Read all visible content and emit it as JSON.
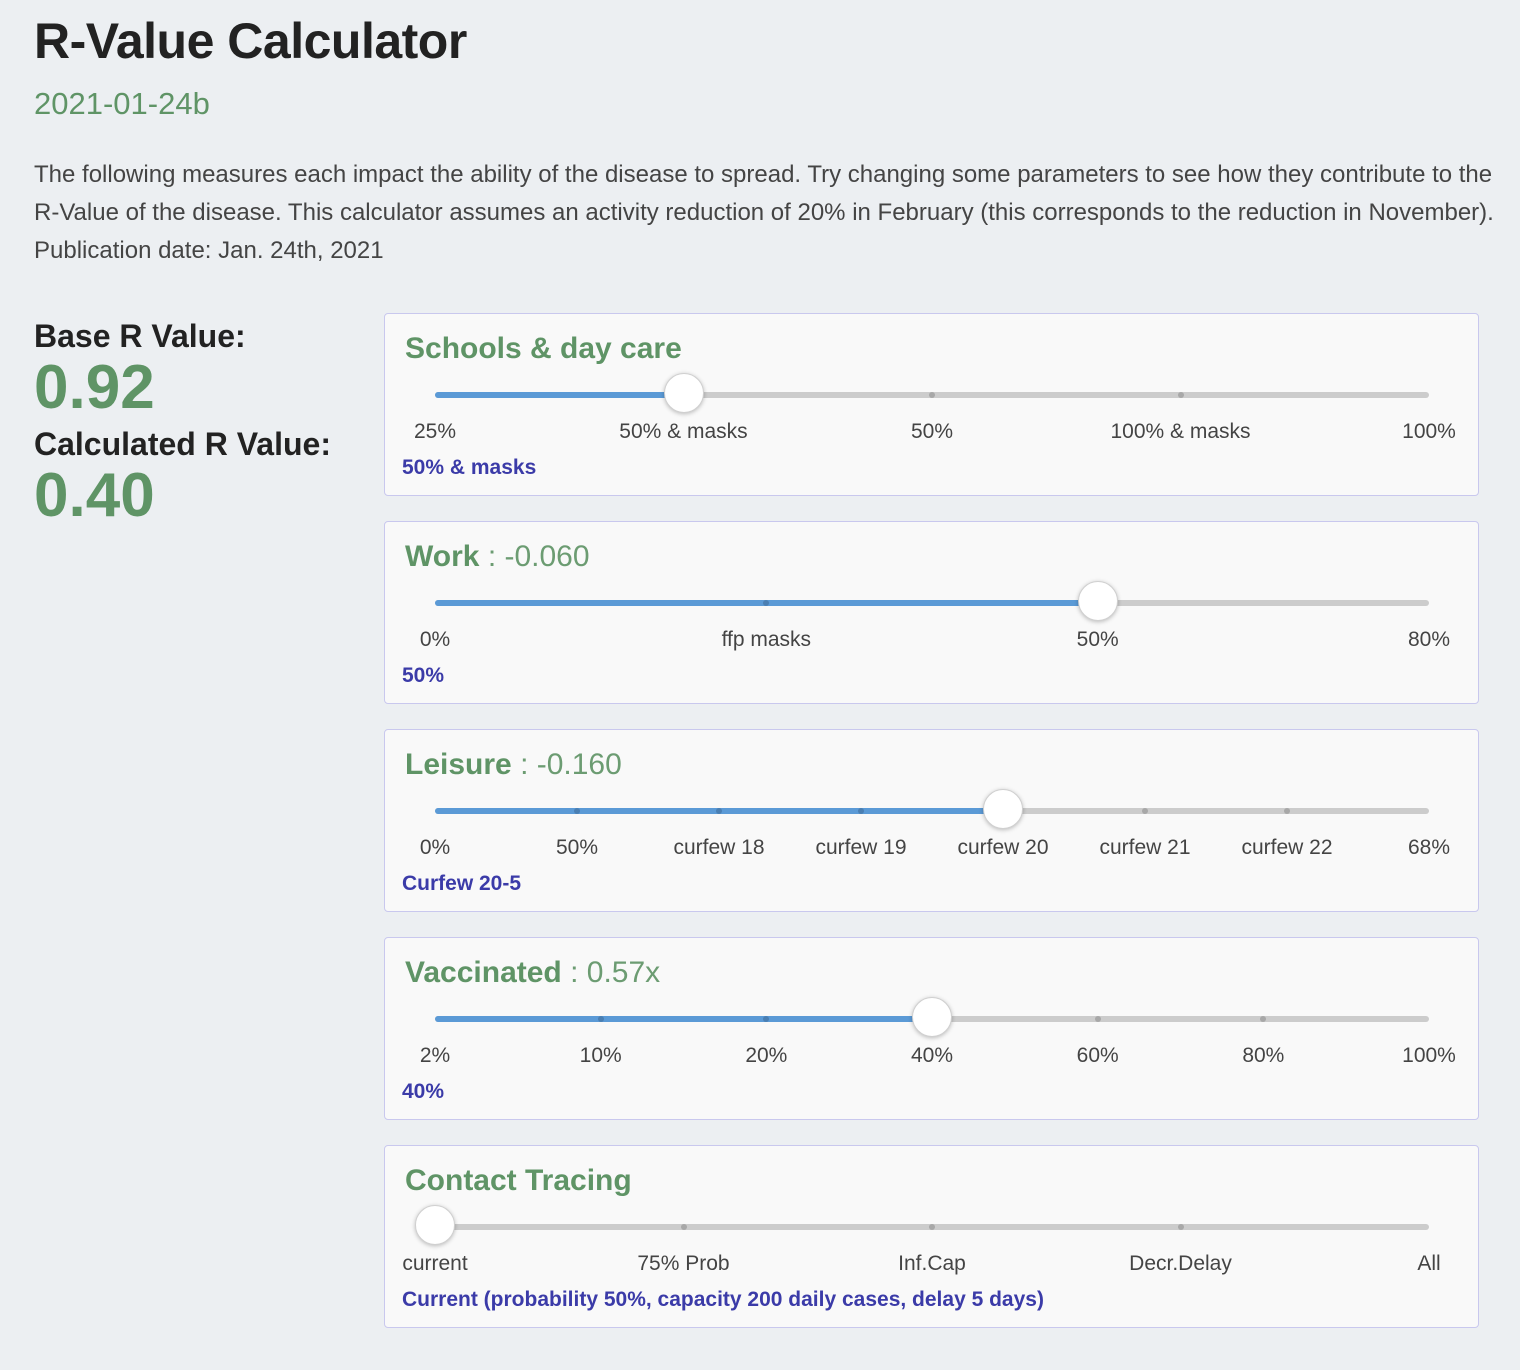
{
  "header": {
    "title": "R-Value Calculator",
    "version": "2021-01-24b",
    "intro": "The following measures each impact the ability of the disease to spread. Try changing some parameters to see how they contribute to the R-Value of the disease. This calculator assumes an activity reduction of 20% in February (this corresponds to the reduction in November). Publication date: Jan. 24th, 2021"
  },
  "summary": {
    "base_label": "Base R Value:",
    "base_value": "0.92",
    "calc_label": "Calculated R Value:",
    "calc_value": "0.40"
  },
  "colors": {
    "accent_green": "#5f9466",
    "track_blue": "#5b9ad6",
    "selected_text": "#3b3ba8"
  },
  "measures": [
    {
      "name": "Schools & day care",
      "impact": "",
      "ticks": [
        "25%",
        "50% & masks",
        "50%",
        "100% & masks",
        "100%"
      ],
      "selected_index": 1,
      "selected_text": "50% & masks"
    },
    {
      "name": "Work",
      "impact": ": -0.060",
      "ticks": [
        "0%",
        "ffp masks",
        "50%",
        "80%"
      ],
      "selected_index": 2,
      "selected_text": "50%"
    },
    {
      "name": "Leisure",
      "impact": ": -0.160",
      "ticks": [
        "0%",
        "50%",
        "curfew 18",
        "curfew 19",
        "curfew 20",
        "curfew 21",
        "curfew 22",
        "68%"
      ],
      "selected_index": 4,
      "selected_text": "Curfew 20-5"
    },
    {
      "name": "Vaccinated",
      "impact": ": 0.57x",
      "ticks": [
        "2%",
        "10%",
        "20%",
        "40%",
        "60%",
        "80%",
        "100%"
      ],
      "selected_index": 3,
      "selected_text": "40%"
    },
    {
      "name": "Contact Tracing",
      "impact": "",
      "ticks": [
        "current",
        "75% Prob",
        "Inf.Cap",
        "Decr.Delay",
        "All"
      ],
      "selected_index": 0,
      "selected_text": "Current (probability 50%, capacity 200 daily cases, delay 5 days)"
    }
  ]
}
